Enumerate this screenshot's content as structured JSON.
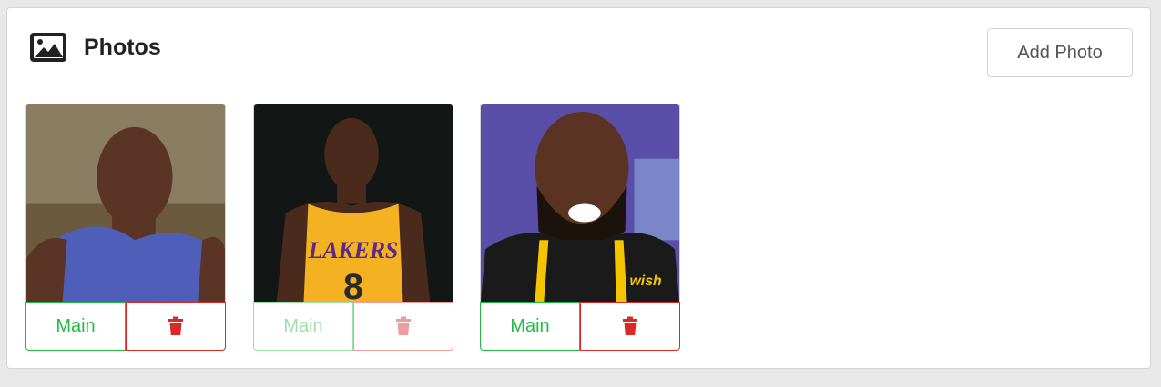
{
  "header": {
    "title": "Photos",
    "icon": "image-icon",
    "add_button_label": "Add Photo"
  },
  "photos": [
    {
      "main_label": "Main",
      "delete_icon": "trash-icon",
      "disabled": false,
      "jersey_color": "#4f5fb9"
    },
    {
      "main_label": "Main",
      "delete_icon": "trash-icon",
      "disabled": true,
      "jersey_color": "#f4b223"
    },
    {
      "main_label": "Main",
      "delete_icon": "trash-icon",
      "disabled": false,
      "jersey_color": "#1a1a1a"
    }
  ],
  "colors": {
    "main_button": "#21ba45",
    "delete_button": "#db2828"
  }
}
